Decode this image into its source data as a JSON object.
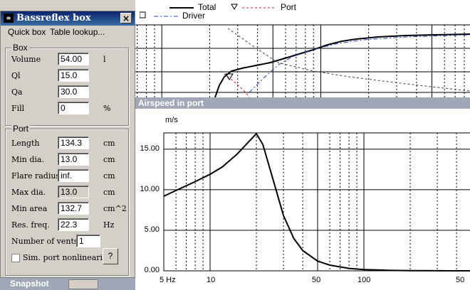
{
  "top_graph": {
    "legend": {
      "total": "Total",
      "driver": "Driver",
      "port": "Port"
    }
  },
  "dialog": {
    "title": "Bassreflex box",
    "close_glyph": "×",
    "menu": {
      "quick_box": "Quick box",
      "table_lookup": "Table lookup..."
    },
    "box_group": {
      "label": "Box",
      "fields": [
        {
          "label": "Volume",
          "value": "54.00",
          "unit": "l"
        },
        {
          "label": "Ql",
          "value": "15.0",
          "unit": ""
        },
        {
          "label": "Qa",
          "value": "30.0",
          "unit": ""
        },
        {
          "label": "Fill",
          "value": "0",
          "unit": "%"
        }
      ]
    },
    "port_group": {
      "label": "Port",
      "fields": [
        {
          "label": "Length",
          "value": "134.3",
          "unit": "cm"
        },
        {
          "label": "Min dia.",
          "value": "13.0",
          "unit": "cm"
        },
        {
          "label": "Flare radius",
          "value": "inf.",
          "unit": "cm"
        },
        {
          "label": "Max dia.",
          "value": "13.0",
          "unit": "cm"
        },
        {
          "label": "Min area",
          "value": "132.7",
          "unit": "cm^2"
        },
        {
          "label": "Res. freq.",
          "value": "22.3",
          "unit": "Hz"
        }
      ],
      "vents_label": "Number of vents",
      "vents_value": "1",
      "nonlin_label": "Sim. port nonlinearity",
      "help_label": "?"
    }
  },
  "airspeed": {
    "title": "Airspeed in port",
    "unit": "m/s",
    "y_ticks": [
      "15.00",
      "10.00",
      "5.00",
      "0.00"
    ],
    "x_ticks": [
      "5 Hz",
      "10",
      "50",
      "100",
      "50"
    ]
  },
  "snapshot": {
    "title": "Snapshot"
  },
  "chart_data": {
    "type": "line",
    "ylabel": "m/s",
    "xscale": "log",
    "xlim": [
      5,
      500
    ],
    "ylim": [
      0,
      17
    ],
    "x": [
      5,
      6,
      8,
      10,
      12,
      15,
      18,
      20,
      22,
      25,
      30,
      35,
      40,
      50,
      60,
      80,
      100,
      150,
      200,
      300,
      500
    ],
    "series": [
      {
        "values": [
          9.2,
          9.9,
          11.0,
          11.9,
          12.8,
          14.4,
          16.0,
          16.9,
          15.6,
          12.0,
          6.8,
          4.0,
          2.5,
          1.2,
          0.7,
          0.3,
          0.15,
          0.05,
          0.02,
          0.01,
          0.0
        ]
      }
    ]
  }
}
